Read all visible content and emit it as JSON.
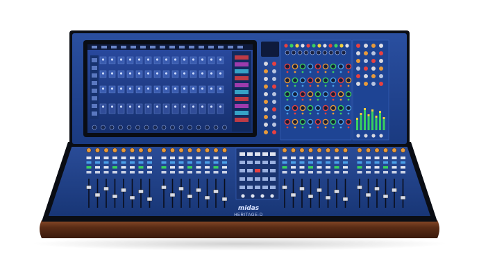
{
  "product": {
    "brand": "midas",
    "model": "HERITAGE-D"
  },
  "colors": {
    "background": "#ffffff",
    "chassis": "#1d3f8c",
    "chassis_dark": "#0f2558",
    "frame": "#0a0d14",
    "wood": "#5a2c16",
    "wood_light": "#7a3f22",
    "screen_bg": "#1a2d6a",
    "knob_orange": "#e89a3a",
    "knob_blue": "#4aa0e8",
    "led_red": "#e84040",
    "led_green": "#3ad060",
    "led_yellow": "#f0d040",
    "meter": "#38d060"
  },
  "icons": [
    "knob-icon",
    "fader-icon",
    "button-icon",
    "meter-icon"
  ]
}
